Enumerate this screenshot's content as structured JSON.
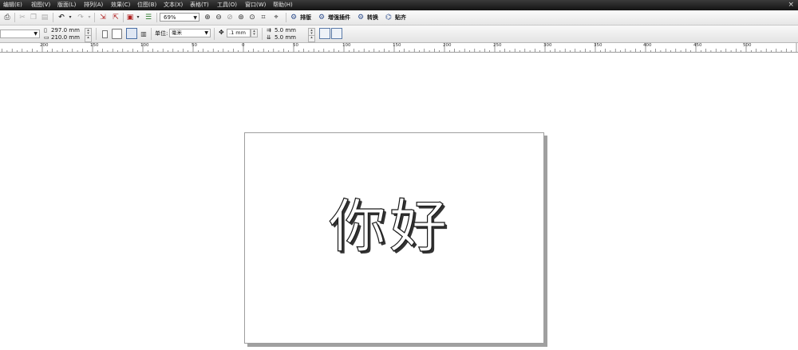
{
  "menu": [
    "编辑(E)",
    "视图(V)",
    "版面(L)",
    "排列(A)",
    "效果(C)",
    "位图(B)",
    "文本(X)",
    "表格(T)",
    "工具(O)",
    "窗口(W)",
    "帮助(H)"
  ],
  "window_controls": {
    "close": "×"
  },
  "toolbar": {
    "zoom": "69%",
    "buttons": [
      "排版",
      "增强插件",
      "转换",
      "贴齐"
    ]
  },
  "property_bar": {
    "width": "297.0 mm",
    "height": "210.0 mm",
    "unit_label": "单位:",
    "unit_value": "毫米",
    "nudge": ".1 mm",
    "duplicate_x": "5.0 mm",
    "duplicate_y": "5.0 mm"
  },
  "ruler": {
    "labels": [
      "200",
      "150",
      "100",
      "50",
      "0",
      "50",
      "100",
      "150",
      "200",
      "250",
      "300",
      "350",
      "400",
      "450",
      "500"
    ]
  },
  "canvas": {
    "text": "你好"
  },
  "colors": {
    "menubar": "#1f1f1f",
    "toolbar": "#ececec",
    "page_shadow": "#a0a0a0"
  }
}
